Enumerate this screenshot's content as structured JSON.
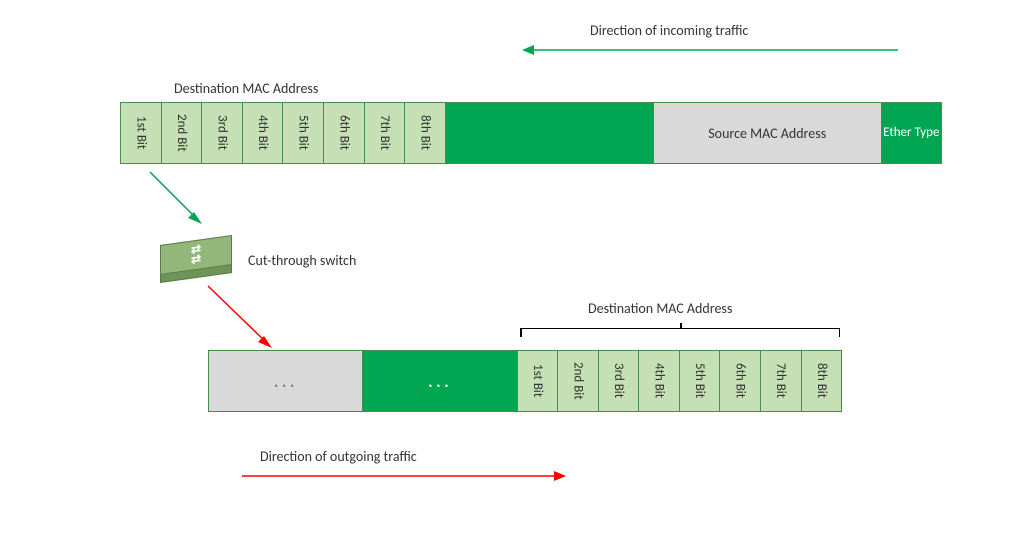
{
  "incoming_direction": "Direction of incoming traffic",
  "outgoing_direction": "Direction of outgoing traffic",
  "dest_mac_label": "Destination MAC Address",
  "dest_mac_label_2": "Destination MAC Address",
  "switch_label": "Cut-through switch",
  "frame_top": {
    "bits": [
      "1st Bit",
      "2nd Bit",
      "3rd Bit",
      "4th Bit",
      "5th Bit",
      "6th Bit",
      "7th Bit",
      "8th Bit"
    ],
    "source_mac": "Source MAC Address",
    "ether_type": "Ether Type"
  },
  "frame_bottom": {
    "leading_gray": "...",
    "leading_green": "...",
    "bits": [
      "1st Bit",
      "2nd Bit",
      "3rd Bit",
      "4th Bit",
      "5th Bit",
      "6th Bit",
      "7th Bit",
      "8th Bit"
    ]
  },
  "colors": {
    "dark_green": "#00a651",
    "light_green": "#c5e0b4",
    "gray": "#d9d9d9",
    "arrow_green": "#00a651",
    "arrow_red": "#ff0000"
  }
}
